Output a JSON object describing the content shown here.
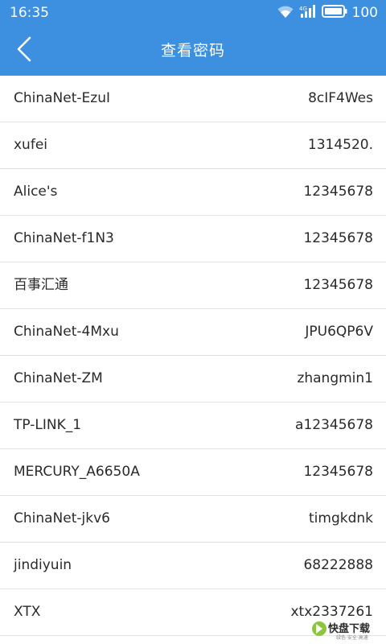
{
  "status_bar": {
    "time": "16:35",
    "battery_level": "100",
    "icons": [
      "wifi-icon",
      "signal-icon",
      "battery-icon"
    ]
  },
  "header": {
    "title": "查看密码",
    "back_icon": "chevron-left-icon"
  },
  "colors": {
    "primary": "#3d8fe0",
    "text": "#2a2a2a",
    "divider": "#e2e2e2",
    "background": "#ffffff"
  },
  "passwords": [
    {
      "ssid": "ChinaNet-EzuI",
      "password": "8cIF4Wes"
    },
    {
      "ssid": "xufei",
      "password": "1314520."
    },
    {
      "ssid": "Alice's",
      "password": "12345678"
    },
    {
      "ssid": "ChinaNet-f1N3",
      "password": "12345678"
    },
    {
      "ssid": "百事汇通",
      "password": "12345678"
    },
    {
      "ssid": "ChinaNet-4Mxu",
      "password": "JPU6QP6V"
    },
    {
      "ssid": "ChinaNet-ZM",
      "password": "zhangmin1"
    },
    {
      "ssid": "TP-LINK_1",
      "password": "a12345678"
    },
    {
      "ssid": "MERCURY_A6650A",
      "password": "12345678"
    },
    {
      "ssid": "ChinaNet-jkv6",
      "password": "timgkdnk"
    },
    {
      "ssid": "jindiyuin",
      "password": "68222888"
    },
    {
      "ssid": "XTX",
      "password": "xtx2337261"
    }
  ],
  "watermark": {
    "text": "快盘下载",
    "subtext": "绿色·安全·高速"
  }
}
